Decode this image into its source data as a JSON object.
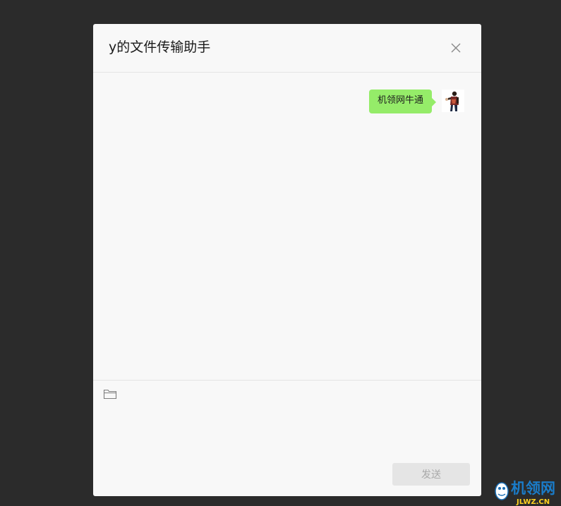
{
  "dialog": {
    "title": "y的文件传输助手",
    "close_icon": "close-icon"
  },
  "chat": {
    "messages": [
      {
        "text": "机领网牛通",
        "sender": "self",
        "bubble_color": "#95ec69"
      }
    ]
  },
  "input": {
    "folder_icon": "folder-icon",
    "placeholder": "",
    "send_label": "发送"
  },
  "watermark": {
    "brand": "机领网",
    "domain": "JLWZ.CN"
  },
  "colors": {
    "backdrop": "#2b2b2b",
    "dialog_bg": "#f8f8f8",
    "bubble_green": "#95ec69",
    "send_disabled_bg": "#e5e5e5",
    "send_disabled_text": "#a9a9a9"
  }
}
